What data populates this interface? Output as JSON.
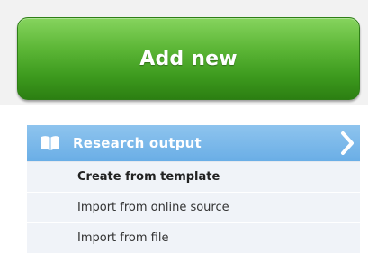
{
  "add_button": {
    "label": "Add new"
  },
  "research_menu": {
    "title": "Research output",
    "items": [
      {
        "label": "Create from template"
      },
      {
        "label": "Import from online source"
      },
      {
        "label": "Import from file"
      }
    ]
  },
  "colors": {
    "button_green": "#4caf2a",
    "header_blue": "#7bb8ea",
    "menu_bg": "#f0f3f8"
  }
}
